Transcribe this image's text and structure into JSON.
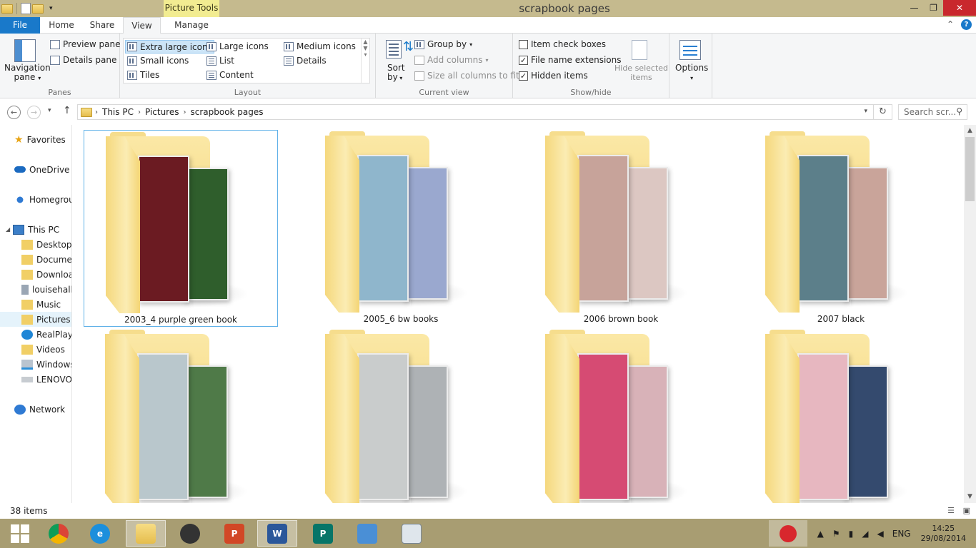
{
  "window": {
    "title": "scrapbook pages",
    "context_tab": "Picture Tools"
  },
  "tabs": {
    "file": "File",
    "home": "Home",
    "share": "Share",
    "view": "View",
    "manage": "Manage"
  },
  "ribbon": {
    "panes": {
      "label": "Panes",
      "navigation_pane": "Navigation\npane",
      "preview_pane": "Preview pane",
      "details_pane": "Details pane"
    },
    "layout": {
      "label": "Layout",
      "items": [
        "Extra large icons",
        "Large icons",
        "Medium icons",
        "Small icons",
        "List",
        "Details",
        "Tiles",
        "Content"
      ],
      "selected": "Extra large icons"
    },
    "current_view": {
      "label": "Current view",
      "sort_by": "Sort\nby",
      "group_by": "Group by",
      "add_columns": "Add columns",
      "size_columns": "Size all columns to fit"
    },
    "show_hide": {
      "label": "Show/hide",
      "item_check_boxes": "Item check boxes",
      "file_name_extensions": "File name extensions",
      "hidden_items": "Hidden items",
      "hide_selected": "Hide selected\nitems",
      "checks": {
        "item_check_boxes": false,
        "file_name_extensions": true,
        "hidden_items": true
      }
    },
    "options": "Options"
  },
  "address": {
    "crumbs": [
      "This PC",
      "Pictures",
      "scrapbook pages"
    ],
    "search_placeholder": "Search scr..."
  },
  "nav": {
    "favorites": "Favorites",
    "onedrive": "OneDrive",
    "homegroup": "Homegrou",
    "this_pc": "This PC",
    "desktop": "Desktop",
    "documents": "Documer",
    "downloads": "Downloa",
    "louisehall": "louisehall",
    "music": "Music",
    "pictures": "Pictures",
    "realplayer": "RealPlaye",
    "videos": "Videos",
    "windows": "Windows",
    "lenovo": "LENOVO",
    "network": "Network"
  },
  "folders": [
    {
      "name": "2003_4 purple green book",
      "c1": "#6b1b22",
      "c2": "#2f5e2c",
      "selected": true
    },
    {
      "name": "2005_6 bw books",
      "c1": "#8fb6cc",
      "c2": "#9aa8cf"
    },
    {
      "name": "2006 brown book",
      "c1": "#c7a39a",
      "c2": "#dcc7c2"
    },
    {
      "name": "2007 black",
      "c1": "#5c7f8a",
      "c2": "#c9a49a"
    },
    {
      "name": "",
      "c1": "#b9c7cc",
      "c2": "#4f7a48"
    },
    {
      "name": "",
      "c1": "#c9cccc",
      "c2": "#aeb2b5"
    },
    {
      "name": "",
      "c1": "#d64b73",
      "c2": "#d8b2b8"
    },
    {
      "name": "",
      "c1": "#e7b7c0",
      "c2": "#344a6e"
    }
  ],
  "status": {
    "item_count": "38 items"
  },
  "taskbar": {
    "time": "14:25",
    "date": "29/08/2014",
    "lang": "ENG"
  },
  "colors": {
    "accent": "#1979ca",
    "titlebar": "#c5ba8e",
    "context_tab": "#f2ec91",
    "taskbar": "#a89d72"
  }
}
